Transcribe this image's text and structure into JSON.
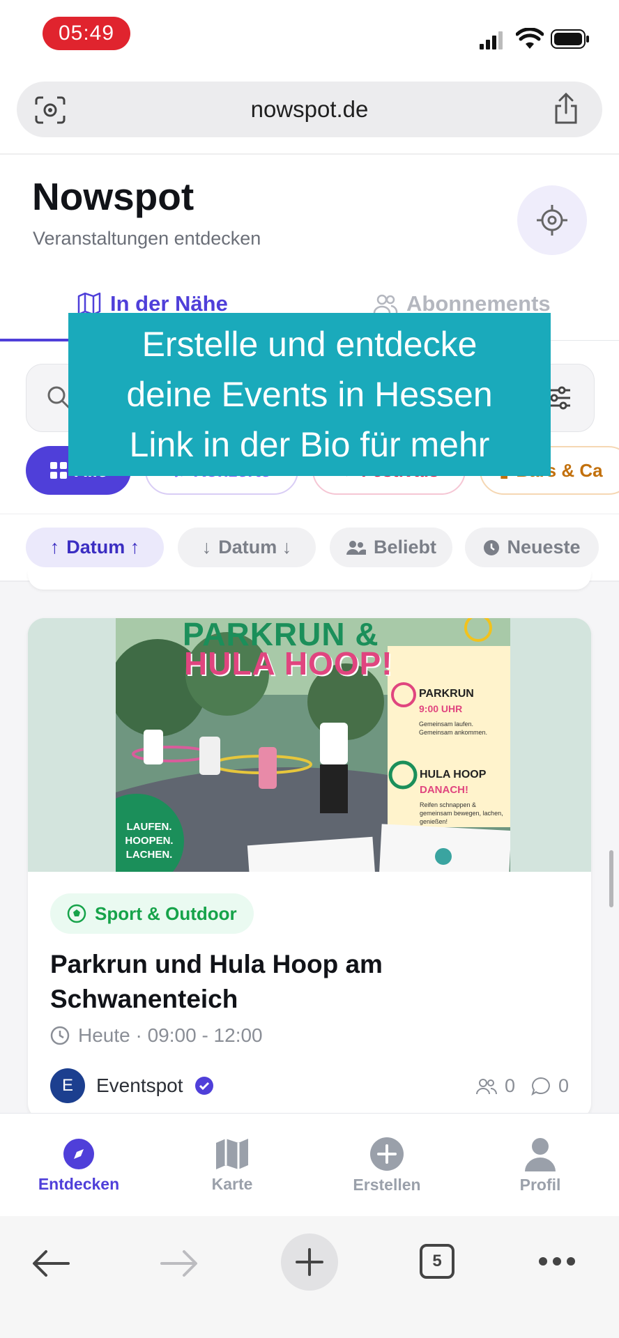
{
  "status_bar": {
    "time": "05:49"
  },
  "browser": {
    "url": "nowspot.de",
    "tab_count": "5"
  },
  "header": {
    "title": "Nowspot",
    "subtitle": "Veranstaltungen entdecken"
  },
  "tabs": [
    {
      "label": "In der Nähe"
    },
    {
      "label": "Abonnements"
    }
  ],
  "categories": [
    {
      "label": "Alle"
    },
    {
      "label": "Konzerte"
    },
    {
      "label": "Festivals"
    },
    {
      "label": "Bars & Ca"
    }
  ],
  "sort": [
    {
      "label": "Datum ↑",
      "prefix": "↑"
    },
    {
      "label": "Datum ↓",
      "prefix": "↓"
    },
    {
      "label": "Beliebt"
    },
    {
      "label": "Neueste"
    }
  ],
  "event": {
    "category": "Sport & Outdoor",
    "title": "Parkrun und Hula Hoop am Schwanenteich",
    "time": "Heute · 09:00 - 12:00",
    "organizer": "Eventspot",
    "organizer_initial": "E",
    "participants": "0",
    "comments": "0",
    "poster": {
      "headline1": "PARKRUN &",
      "headline2": "HULA HOOP!",
      "box1_title": "PARKRUN",
      "box1_time": "9:00 UHR",
      "box1_text": "Gemeinsam laufen. Gemeinsam ankommen.",
      "box2_title": "HULA HOOP",
      "box2_sub": "DANACH!",
      "box2_text": "Reifen schnappen & gemeinsam bewegen, lachen, genießen!",
      "badge": "LAUFEN. HOOPEN. LACHEN."
    }
  },
  "caption": {
    "line1": "Erstelle und entdecke",
    "line2": "deine Events in Hessen",
    "line3": "Link in der Bio für mehr"
  },
  "bottom_nav": [
    {
      "label": "Entdecken"
    },
    {
      "label": "Karte"
    },
    {
      "label": "Erstellen"
    },
    {
      "label": "Profil"
    }
  ],
  "colors": {
    "accent": "#4f3fd9",
    "caption_bg": "#1aaabb",
    "sport_green": "#16a34a",
    "time_pill": "#e0242e"
  }
}
